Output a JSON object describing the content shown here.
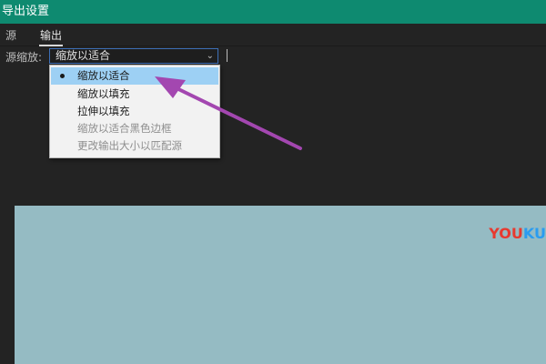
{
  "window": {
    "title": "导出设置"
  },
  "tabs": [
    {
      "label": "源"
    },
    {
      "label": "输出"
    }
  ],
  "scale": {
    "label": "源缩放:",
    "selected_value": "缩放以适合",
    "options": [
      {
        "label": "缩放以适合",
        "selected": true,
        "enabled": true
      },
      {
        "label": "缩放以填充",
        "selected": false,
        "enabled": true
      },
      {
        "label": "拉伸以填充",
        "selected": false,
        "enabled": true
      },
      {
        "label": "缩放以适合黑色边框",
        "selected": false,
        "enabled": false
      },
      {
        "label": "更改输出大小以匹配源",
        "selected": false,
        "enabled": false
      }
    ]
  },
  "preview": {
    "watermark_logo": "YOUKU",
    "watermark_parts": [
      "YOU",
      "KU"
    ],
    "background_color": "#95bbc3"
  },
  "colors": {
    "titlebar": "#0e8a70",
    "annotation_arrow": "#a347b0",
    "selection": "#9dd0f4"
  }
}
